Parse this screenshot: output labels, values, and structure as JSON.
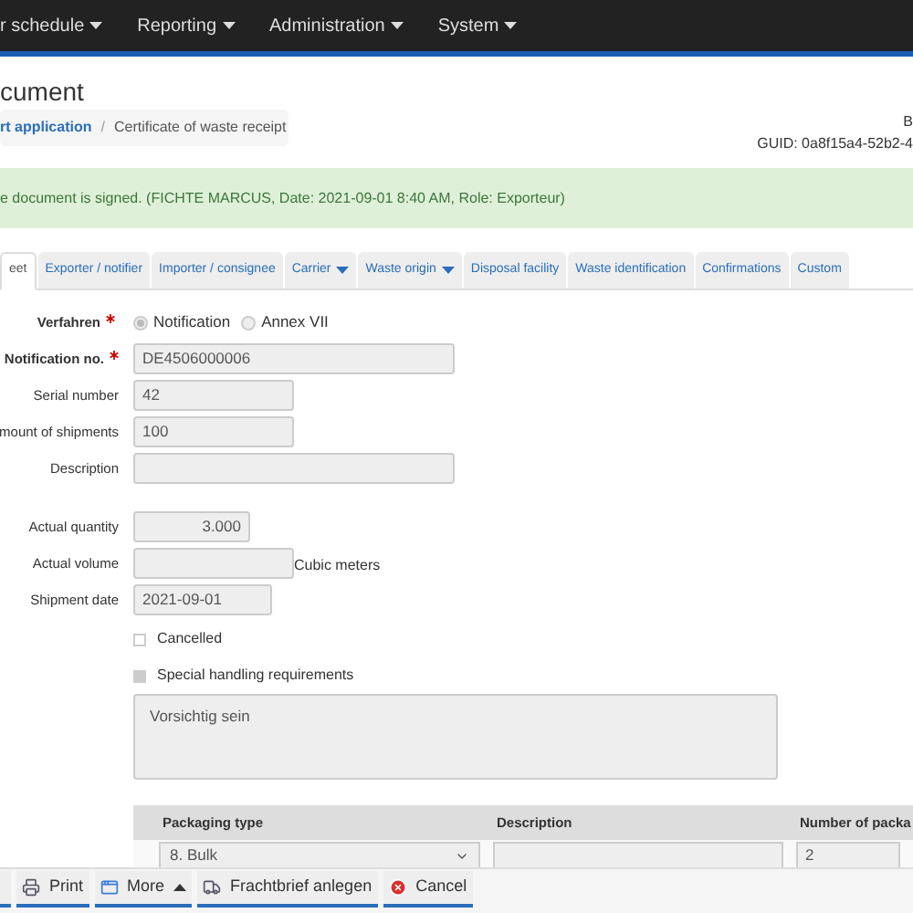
{
  "nav_menu": [
    {
      "label": "r schedule"
    },
    {
      "label": "Reporting"
    },
    {
      "label": "Administration"
    },
    {
      "label": "System"
    }
  ],
  "page_title": "cument",
  "breadcrumb": [
    {
      "label": "rt application",
      "link": true
    },
    {
      "label": "Certificate of waste receipt",
      "link": false
    }
  ],
  "breadcrumb_separator": "/",
  "doc_info": [
    "B",
    "GUID: 0a8f15a4-52b2-4"
  ],
  "alert": "e document is signed. (FICHTE MARCUS, Date: 2021-09-01 8:40 AM, Role: Exporteur)",
  "tabs": [
    {
      "label": "eet",
      "selected": true,
      "dropdown": false
    },
    {
      "label": "Exporter / notifier",
      "selected": false,
      "dropdown": false
    },
    {
      "label": "Importer / consignee",
      "selected": false,
      "dropdown": false
    },
    {
      "label": "Carrier",
      "selected": false,
      "dropdown": true
    },
    {
      "label": "Waste origin",
      "selected": false,
      "dropdown": true
    },
    {
      "label": "Disposal facility",
      "selected": false,
      "dropdown": false
    },
    {
      "label": "Waste identification",
      "selected": false,
      "dropdown": false
    },
    {
      "label": "Confirmations",
      "selected": false,
      "dropdown": false
    },
    {
      "label": "Custom",
      "selected": false,
      "dropdown": false
    }
  ],
  "form": [
    {
      "kind": "radio",
      "label": "Verfahren",
      "required": true,
      "options": [
        {
          "label": "Notification",
          "selected": true
        },
        {
          "label": "Annex VII",
          "selected": false
        }
      ]
    },
    {
      "kind": "field",
      "label": "Notification no.",
      "required": true,
      "value": "DE4506000006"
    },
    {
      "kind": "field",
      "label": "Serial number",
      "required": false,
      "value": "42"
    },
    {
      "kind": "field",
      "label": "mount of shipments",
      "required": false,
      "value": "100"
    },
    {
      "kind": "field",
      "label": "Description",
      "required": false
    },
    {
      "kind": "spacer"
    },
    {
      "kind": "field",
      "label": "Actual quantity",
      "required": false,
      "value": "3.000"
    },
    {
      "kind": "field",
      "label": "Actual volume",
      "required": false,
      "unit": "Cubic meters"
    },
    {
      "kind": "field",
      "label": "Shipment date",
      "required": false,
      "value": "2021-09-01"
    },
    {
      "kind": "checkbox",
      "label": "Cancelled",
      "checked": false
    },
    {
      "kind": "checkbox",
      "label": "Special handling requirements",
      "checked": true
    },
    {
      "kind": "textarea",
      "value": "Vorsichtig sein"
    }
  ],
  "packaging_table": {
    "columns": [
      "Packaging type",
      "Description",
      "Number of packa"
    ],
    "rows": [
      {
        "packaging_type": "8. Bulk",
        "number": "2"
      }
    ]
  },
  "toolbar": [
    {
      "label": "Print",
      "caret": false
    },
    {
      "label": "More",
      "caret": true
    },
    {
      "label": "Frachtbrief anlegen",
      "caret": false
    },
    {
      "label": "Cancel",
      "caret": false
    }
  ]
}
